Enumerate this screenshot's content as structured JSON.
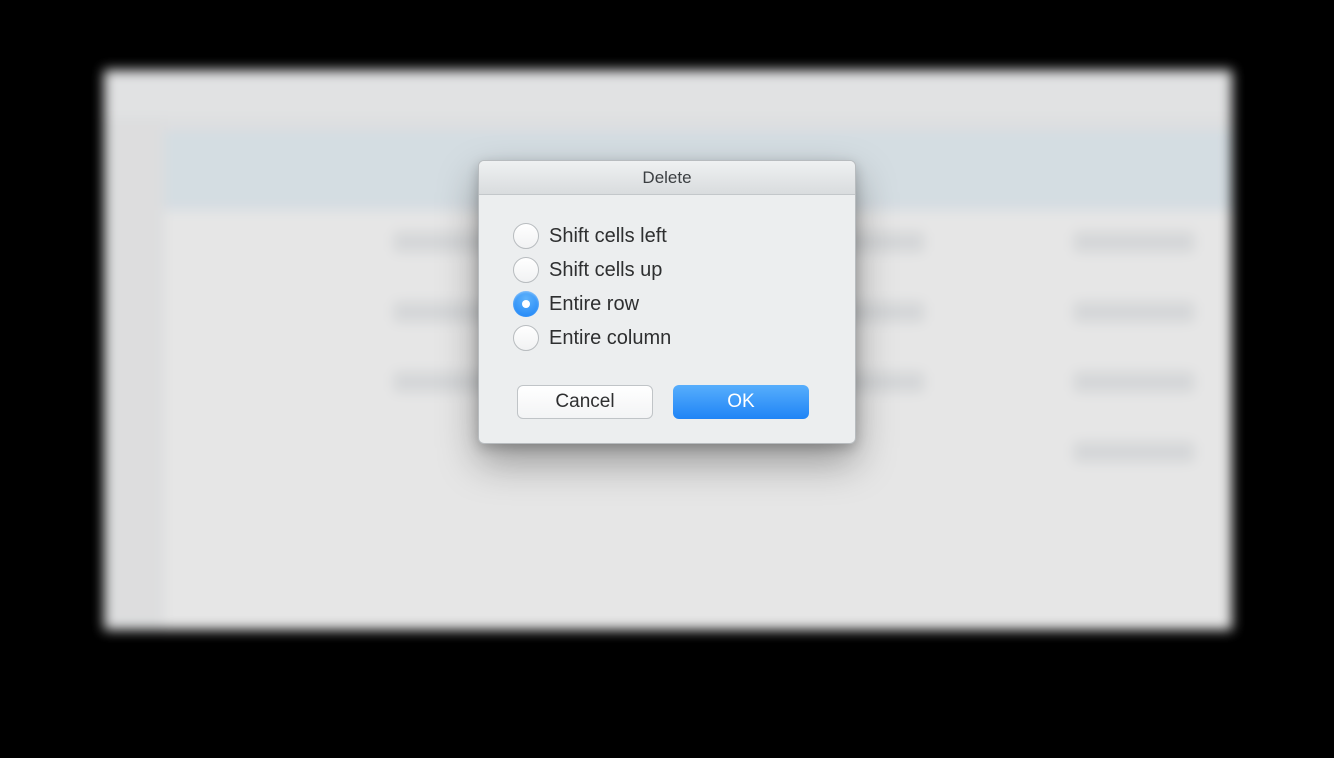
{
  "dialog": {
    "title": "Delete",
    "options": [
      {
        "label": "Shift cells left",
        "selected": false
      },
      {
        "label": "Shift cells up",
        "selected": false
      },
      {
        "label": "Entire row",
        "selected": true
      },
      {
        "label": "Entire column",
        "selected": false
      }
    ],
    "cancel_label": "Cancel",
    "ok_label": "OK"
  }
}
